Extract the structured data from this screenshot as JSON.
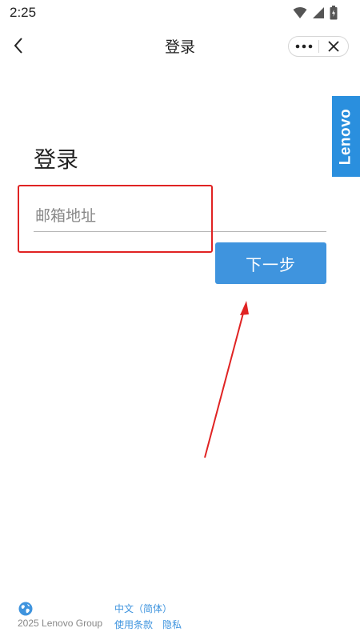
{
  "status_bar": {
    "time": "2:25",
    "icons": [
      "wifi-icon",
      "signal-icon",
      "battery-icon"
    ]
  },
  "nav": {
    "title": "登录",
    "back_icon": "chevron-left-icon",
    "more_icon": "more-icon",
    "close_icon": "close-icon"
  },
  "brand": {
    "label": "Lenovo",
    "color": "#2a8fde"
  },
  "login": {
    "heading": "登录",
    "email_placeholder": "邮箱地址",
    "email_value": "",
    "next_label": "下一步",
    "button_color": "#3f94de"
  },
  "annotation": {
    "box_color": "#e02323",
    "arrow_color": "#e02323"
  },
  "footer": {
    "globe_icon": "globe-icon",
    "copyright": "2025 Lenovo Group",
    "language": "中文（简体）",
    "terms": "使用条款",
    "privacy": "隐私"
  }
}
